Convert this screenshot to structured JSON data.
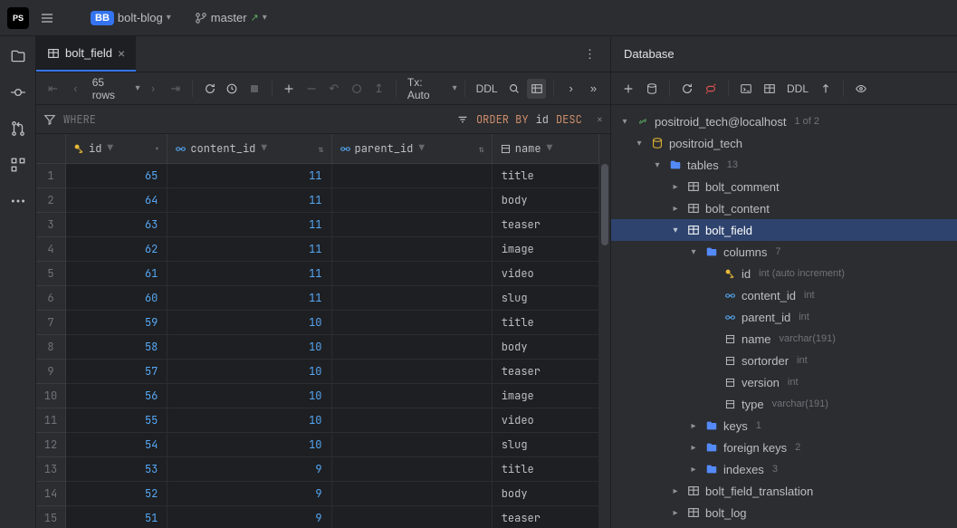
{
  "titlebar": {
    "app_icon": "PS",
    "project_badge": "BB",
    "project_name": "bolt-blog",
    "branch_name": "master"
  },
  "tab": {
    "name": "bolt_field"
  },
  "toolbar": {
    "rows_text": "65 rows",
    "tx_text": "Tx: Auto",
    "ddl_text": "DDL"
  },
  "filter": {
    "where_placeholder": "WHERE",
    "order_by_kw": "ORDER BY",
    "order_col": "id",
    "order_dir": "DESC"
  },
  "columns": {
    "id": "id",
    "content_id": "content_id",
    "parent_id": "parent_id",
    "name": "name"
  },
  "rows": [
    {
      "n": "1",
      "id": "65",
      "cid": "11",
      "pid": "<null>",
      "name": "title"
    },
    {
      "n": "2",
      "id": "64",
      "cid": "11",
      "pid": "<null>",
      "name": "body"
    },
    {
      "n": "3",
      "id": "63",
      "cid": "11",
      "pid": "<null>",
      "name": "teaser"
    },
    {
      "n": "4",
      "id": "62",
      "cid": "11",
      "pid": "<null>",
      "name": "image"
    },
    {
      "n": "5",
      "id": "61",
      "cid": "11",
      "pid": "<null>",
      "name": "video"
    },
    {
      "n": "6",
      "id": "60",
      "cid": "11",
      "pid": "<null>",
      "name": "slug"
    },
    {
      "n": "7",
      "id": "59",
      "cid": "10",
      "pid": "<null>",
      "name": "title"
    },
    {
      "n": "8",
      "id": "58",
      "cid": "10",
      "pid": "<null>",
      "name": "body"
    },
    {
      "n": "9",
      "id": "57",
      "cid": "10",
      "pid": "<null>",
      "name": "teaser"
    },
    {
      "n": "10",
      "id": "56",
      "cid": "10",
      "pid": "<null>",
      "name": "image"
    },
    {
      "n": "11",
      "id": "55",
      "cid": "10",
      "pid": "<null>",
      "name": "video"
    },
    {
      "n": "12",
      "id": "54",
      "cid": "10",
      "pid": "<null>",
      "name": "slug"
    },
    {
      "n": "13",
      "id": "53",
      "cid": "9",
      "pid": "<null>",
      "name": "title"
    },
    {
      "n": "14",
      "id": "52",
      "cid": "9",
      "pid": "<null>",
      "name": "body"
    },
    {
      "n": "15",
      "id": "51",
      "cid": "9",
      "pid": "<null>",
      "name": "teaser"
    }
  ],
  "db_panel": {
    "title": "Database",
    "ddl_text": "DDL",
    "datasource": "positroid_tech@localhost",
    "datasource_hint": "1 of 2",
    "schema": "positroid_tech",
    "tables_label": "tables",
    "tables_count": "13",
    "tables": {
      "bolt_comment": "bolt_comment",
      "bolt_content": "bolt_content",
      "bolt_field": "bolt_field",
      "bolt_field_translation": "bolt_field_translation",
      "bolt_log": "bolt_log"
    },
    "columns_label": "columns",
    "columns_count": "7",
    "cols": {
      "id": {
        "name": "id",
        "type": "int (auto increment)"
      },
      "content_id": {
        "name": "content_id",
        "type": "int"
      },
      "parent_id": {
        "name": "parent_id",
        "type": "int"
      },
      "name": {
        "name": "name",
        "type": "varchar(191)"
      },
      "sortorder": {
        "name": "sortorder",
        "type": "int"
      },
      "version": {
        "name": "version",
        "type": "int"
      },
      "type": {
        "name": "type",
        "type": "varchar(191)"
      }
    },
    "keys_label": "keys",
    "keys_count": "1",
    "fk_label": "foreign keys",
    "fk_count": "2",
    "idx_label": "indexes",
    "idx_count": "3"
  }
}
